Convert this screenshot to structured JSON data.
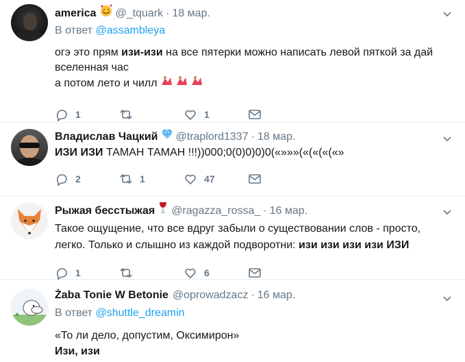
{
  "tweets": [
    {
      "name": "america",
      "emoji_icon": "smiling-face-with-hearts-icon",
      "handle": "@_tquark",
      "dot": "·",
      "time": "18 мар.",
      "reply_prefix": "В ответ",
      "reply_to": "@assambleya",
      "lines": [
        {
          "parts": [
            {
              "t": "огэ это прям ",
              "b": false
            },
            {
              "t": "изи-изи",
              "b": true
            },
            {
              "t": " на все пятерки можно написать левой пяткой за дай",
              "b": false
            }
          ]
        },
        {
          "parts": [
            {
              "t": "вселенная час",
              "b": false
            }
          ]
        },
        {
          "parts": [
            {
              "t": "а потом лето и чилл ",
              "b": false
            }
          ]
        }
      ],
      "trailing_icons": [
        "dancer-emoji-icon",
        "dancer-emoji-icon",
        "dancer-emoji-icon"
      ],
      "replies": "1",
      "retweets": "",
      "likes": "1"
    },
    {
      "name": "Владислав Чацкий",
      "emoji_icon": "gem-icon",
      "handle": "@traplord1337",
      "dot": "·",
      "time": "18 мар.",
      "lines": [
        {
          "parts": [
            {
              "t": "ИЗИ ИЗИ",
              "b": true
            },
            {
              "t": " ТАМАН ТАМАН !!!))000;0(0)0)0)0(«»»»(«(«(«(«»",
              "b": false
            }
          ]
        }
      ],
      "replies": "2",
      "retweets": "1",
      "likes": "47"
    },
    {
      "name": "Рыжая бесстыжая",
      "emoji_icon": "wine-glass-icon",
      "handle": "@ragazza_rossa_",
      "dot": "·",
      "time": "16 мар.",
      "lines": [
        {
          "parts": [
            {
              "t": "Такое ощущение, что все вдруг забыли о существовании слов - просто,",
              "b": false
            }
          ]
        },
        {
          "parts": [
            {
              "t": "легко. Только и слышно из каждой подворотни: ",
              "b": false
            },
            {
              "t": "изи изи изи изи ИЗИ",
              "b": true
            }
          ]
        }
      ],
      "replies": "1",
      "retweets": "",
      "likes": "6"
    },
    {
      "name": "Żaba Tonie W Betonie",
      "handle": "@oprowadzacz",
      "dot": "·",
      "time": "16 мар.",
      "reply_prefix": "В ответ",
      "reply_to": "@shuttle_dreamin",
      "lines": [
        {
          "parts": [
            {
              "t": "«То ли дело, допустим, Оксимирон»",
              "b": false
            }
          ]
        },
        {
          "parts": [
            {
              "t": "Изи, изи",
              "b": true
            }
          ]
        }
      ]
    }
  ],
  "icons": {
    "reply": "reply-icon",
    "retweet": "retweet-icon",
    "like": "heart-icon",
    "dm": "envelope-icon",
    "caret": "chevron-down-icon"
  },
  "colors": {
    "link": "#1da1f2",
    "secondary": "#657786",
    "verified_gem": "#4aa8f0"
  }
}
